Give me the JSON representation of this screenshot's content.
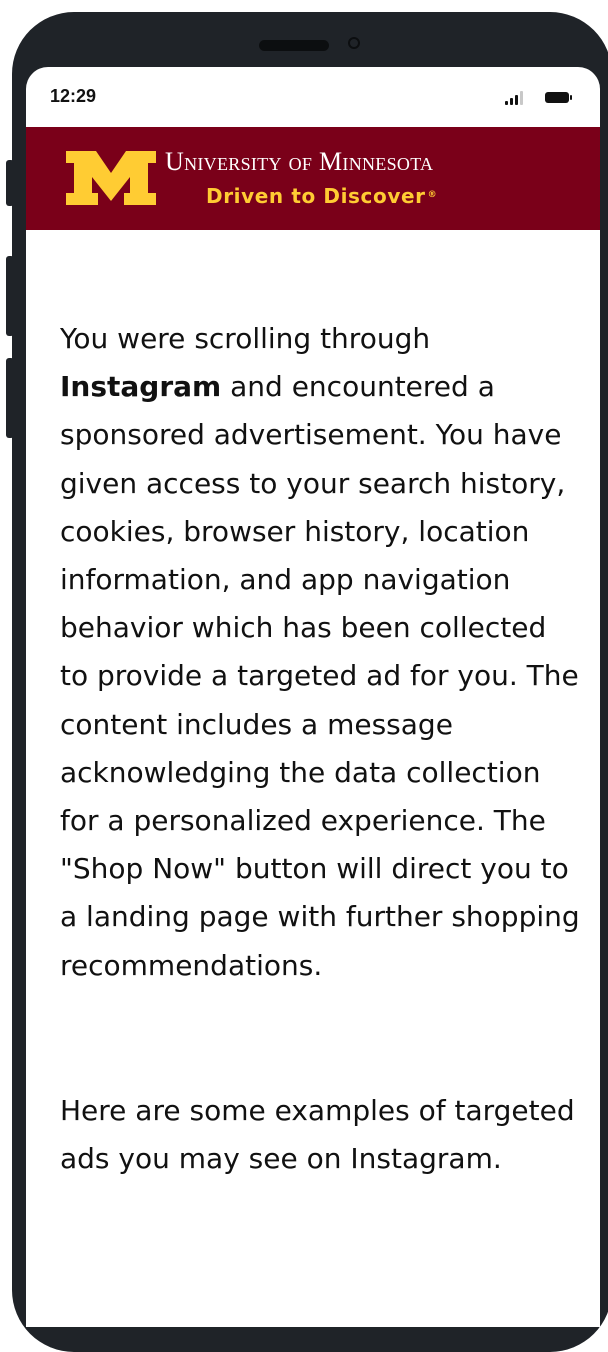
{
  "status_bar": {
    "time": "12:29",
    "signal_icon": "cellular-signal-icon",
    "battery_icon": "battery-icon"
  },
  "banner": {
    "logo_icon": "university-m-logo-icon",
    "university_name": "University of Minnesota",
    "tagline": "Driven to Discover",
    "registered_mark": "®",
    "background_color": "#7a0019",
    "accent_color": "#ffcc33"
  },
  "content": {
    "paragraph1_prefix": "You were scrolling through ",
    "paragraph1_bold": "Instagram",
    "paragraph1_suffix": " and encountered a sponsored advertisement. You have given access to your search history, cookies, browser history, location information, and app navigation behavior which has been collected to provide a targeted ad for you. The content includes a message acknowledging the data collection for a personalized experience. The \"Shop Now\" button will direct you to a landing page with further shopping recommendations.",
    "paragraph2": "Here are some examples of targeted ads you may see on Instagram."
  }
}
